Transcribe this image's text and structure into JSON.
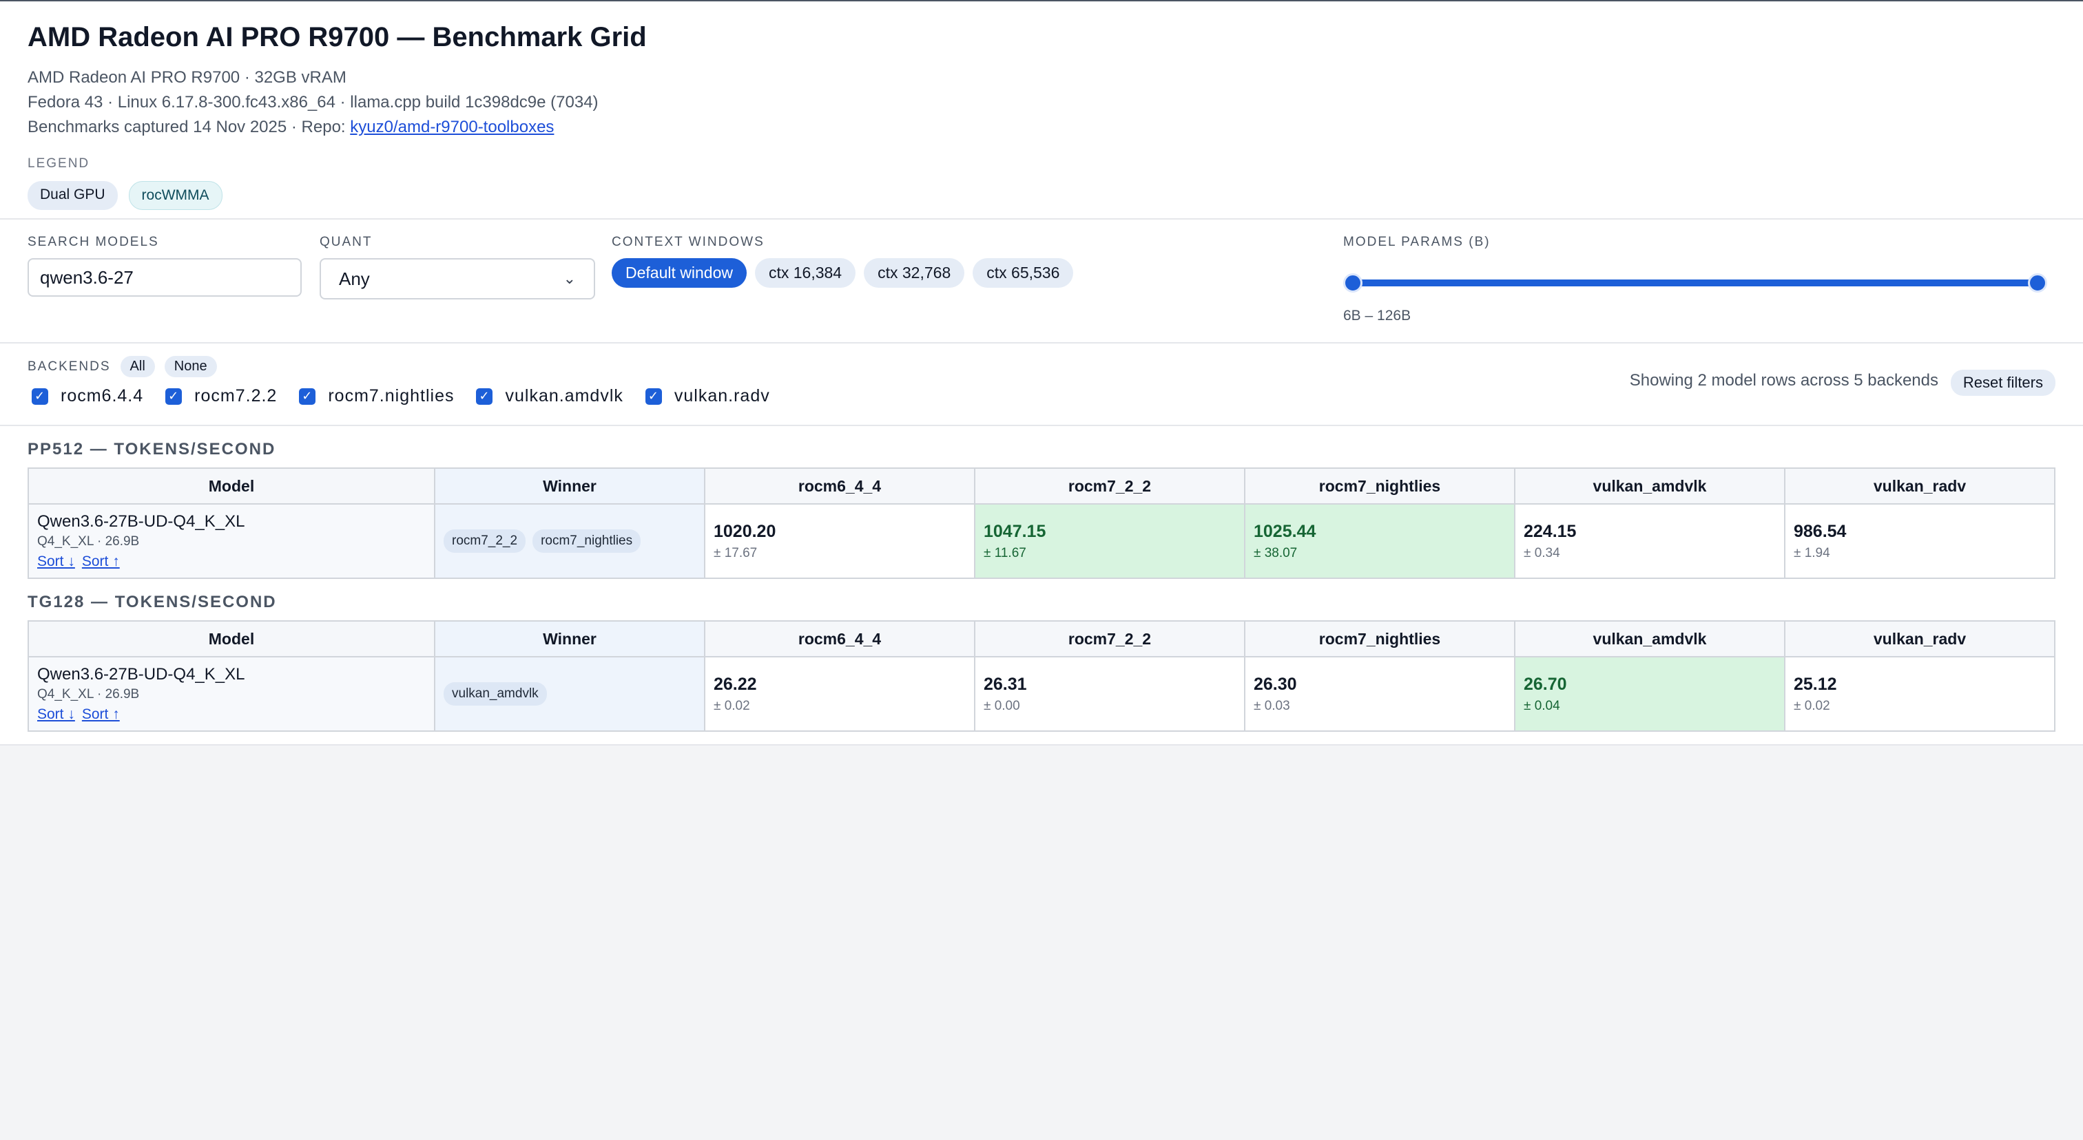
{
  "header": {
    "title": "AMD Radeon AI PRO R9700 — Benchmark Grid",
    "line1": "AMD Radeon AI PRO R9700 · 32GB vRAM",
    "line2": "Fedora 43 · Linux 6.17.8-300.fc43.x86_64 · llama.cpp build 1c398dc9e (7034)",
    "line3_prefix": "Benchmarks captured 14 Nov 2025 · Repo: ",
    "repo_link": "kyuz0/amd-r9700-toolboxes",
    "legend_label": "LEGEND",
    "legend": [
      "Dual GPU",
      "rocWMMA"
    ]
  },
  "filters": {
    "search_label": "SEARCH MODELS",
    "search_value": "qwen3.6-27",
    "quant_label": "QUANT",
    "quant_value": "Any",
    "context_label": "CONTEXT WINDOWS",
    "context_options": [
      "Default window",
      "ctx 16,384",
      "ctx 32,768",
      "ctx 65,536"
    ],
    "params_label": "MODEL PARAMS (B)",
    "params_range": "6B – 126B"
  },
  "backends": {
    "label": "BACKENDS",
    "all": "All",
    "none": "None",
    "items": [
      "rocm6.4.4",
      "rocm7.2.2",
      "rocm7.nightlies",
      "vulkan.amdvlk",
      "vulkan.radv"
    ],
    "showing": "Showing 2 model rows across 5 backends",
    "reset": "Reset filters"
  },
  "columns": [
    "Model",
    "Winner",
    "rocm6_4_4",
    "rocm7_2_2",
    "rocm7_nightlies",
    "vulkan_amdvlk",
    "vulkan_radv"
  ],
  "sort_down": "Sort ↓",
  "sort_up": "Sort ↑",
  "pp512": {
    "title": "PP512 — TOKENS/SECOND",
    "model": "Qwen3.6-27B-UD-Q4_K_XL",
    "model_sub": "Q4_K_XL · 26.9B",
    "winners": [
      "rocm7_2_2",
      "rocm7_nightlies"
    ],
    "cells": [
      {
        "v": "1020.20",
        "e": "± 17.67"
      },
      {
        "v": "1047.15",
        "e": "± 11.67"
      },
      {
        "v": "1025.44",
        "e": "± 38.07"
      },
      {
        "v": "224.15",
        "e": "± 0.34"
      },
      {
        "v": "986.54",
        "e": "± 1.94"
      }
    ]
  },
  "tg128": {
    "title": "TG128 — TOKENS/SECOND",
    "model": "Qwen3.6-27B-UD-Q4_K_XL",
    "model_sub": "Q4_K_XL · 26.9B",
    "winners": [
      "vulkan_amdvlk"
    ],
    "cells": [
      {
        "v": "26.22",
        "e": "± 0.02"
      },
      {
        "v": "26.31",
        "e": "± 0.00"
      },
      {
        "v": "26.30",
        "e": "± 0.03"
      },
      {
        "v": "26.70",
        "e": "± 0.04"
      },
      {
        "v": "25.12",
        "e": "± 0.02"
      }
    ]
  }
}
